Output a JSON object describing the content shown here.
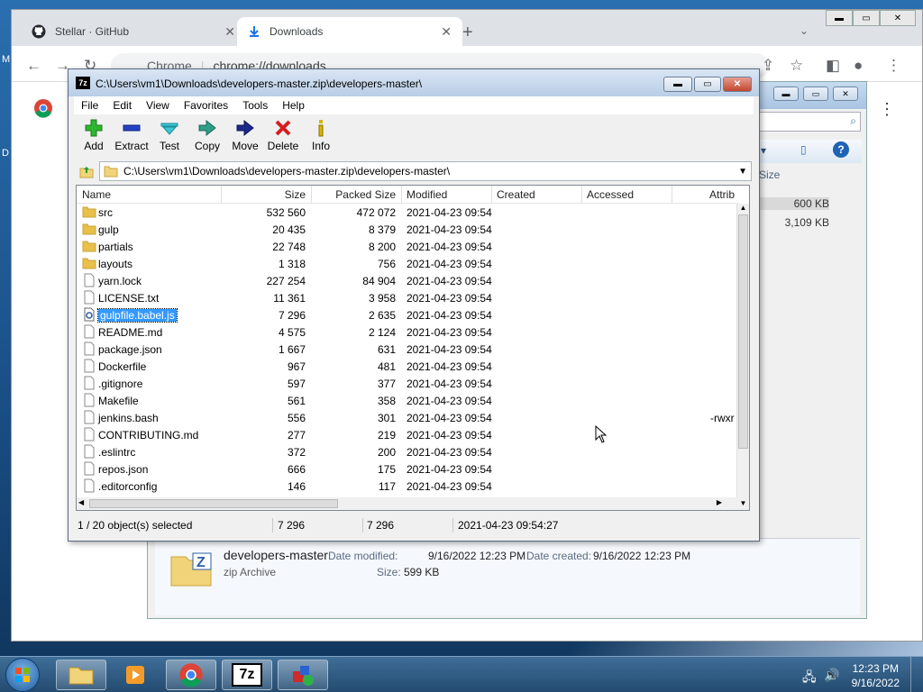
{
  "desktop": {
    "left_label_1": "M",
    "left_label_2": "D"
  },
  "chrome": {
    "tabs": [
      {
        "title": "Stellar · GitHub"
      },
      {
        "title": "Downloads"
      }
    ],
    "omnibox": {
      "site": "Chrome",
      "url": "chrome://downloads"
    }
  },
  "explorer": {
    "column_size": "Size",
    "sizes": [
      "600 KB",
      "3,109 KB"
    ],
    "details": {
      "name": "developers-master",
      "type": "zip Archive",
      "date_modified_label": "Date modified:",
      "date_modified": "9/16/2022 12:23 PM",
      "date_created_label": "Date created:",
      "date_created": "9/16/2022 12:23 PM",
      "size_label": "Size:",
      "size": "599 KB"
    }
  },
  "zip": {
    "title": "C:\\Users\\vm1\\Downloads\\developers-master.zip\\developers-master\\",
    "menu": [
      "File",
      "Edit",
      "View",
      "Favorites",
      "Tools",
      "Help"
    ],
    "toolbar": {
      "add": "Add",
      "extract": "Extract",
      "test": "Test",
      "copy": "Copy",
      "move": "Move",
      "delete": "Delete",
      "info": "Info"
    },
    "address": "C:\\Users\\vm1\\Downloads\\developers-master.zip\\developers-master\\",
    "columns": {
      "name": "Name",
      "size": "Size",
      "packed": "Packed Size",
      "modified": "Modified",
      "created": "Created",
      "accessed": "Accessed",
      "attrib": "Attrib"
    },
    "rows": [
      {
        "name": "src",
        "size": "532 560",
        "packed": "472 072",
        "modified": "2021-04-23 09:54",
        "attrib": "",
        "type": "folder"
      },
      {
        "name": "gulp",
        "size": "20 435",
        "packed": "8 379",
        "modified": "2021-04-23 09:54",
        "attrib": "",
        "type": "folder"
      },
      {
        "name": "partials",
        "size": "22 748",
        "packed": "8 200",
        "modified": "2021-04-23 09:54",
        "attrib": "",
        "type": "folder"
      },
      {
        "name": "layouts",
        "size": "1 318",
        "packed": "756",
        "modified": "2021-04-23 09:54",
        "attrib": "",
        "type": "folder"
      },
      {
        "name": "yarn.lock",
        "size": "227 254",
        "packed": "84 904",
        "modified": "2021-04-23 09:54",
        "attrib": "",
        "type": "file"
      },
      {
        "name": "LICENSE.txt",
        "size": "11 361",
        "packed": "3 958",
        "modified": "2021-04-23 09:54",
        "attrib": "",
        "type": "file"
      },
      {
        "name": "gulpfile.babel.js",
        "size": "7 296",
        "packed": "2 635",
        "modified": "2021-04-23 09:54",
        "attrib": "",
        "type": "script"
      },
      {
        "name": "README.md",
        "size": "4 575",
        "packed": "2 124",
        "modified": "2021-04-23 09:54",
        "attrib": "",
        "type": "file"
      },
      {
        "name": "package.json",
        "size": "1 667",
        "packed": "631",
        "modified": "2021-04-23 09:54",
        "attrib": "",
        "type": "file"
      },
      {
        "name": "Dockerfile",
        "size": "967",
        "packed": "481",
        "modified": "2021-04-23 09:54",
        "attrib": "",
        "type": "file"
      },
      {
        "name": ".gitignore",
        "size": "597",
        "packed": "377",
        "modified": "2021-04-23 09:54",
        "attrib": "",
        "type": "file"
      },
      {
        "name": "Makefile",
        "size": "561",
        "packed": "358",
        "modified": "2021-04-23 09:54",
        "attrib": "",
        "type": "file"
      },
      {
        "name": "jenkins.bash",
        "size": "556",
        "packed": "301",
        "modified": "2021-04-23 09:54",
        "attrib": "-rwxr",
        "type": "file"
      },
      {
        "name": "CONTRIBUTING.md",
        "size": "277",
        "packed": "219",
        "modified": "2021-04-23 09:54",
        "attrib": "",
        "type": "file"
      },
      {
        "name": ".eslintrc",
        "size": "372",
        "packed": "200",
        "modified": "2021-04-23 09:54",
        "attrib": "",
        "type": "file"
      },
      {
        "name": "repos.json",
        "size": "666",
        "packed": "175",
        "modified": "2021-04-23 09:54",
        "attrib": "",
        "type": "file"
      },
      {
        "name": ".editorconfig",
        "size": "146",
        "packed": "117",
        "modified": "2021-04-23 09:54",
        "attrib": "",
        "type": "file"
      }
    ],
    "selected_row": "gulpfile.babel.js",
    "status": {
      "selection": "1 / 20 object(s) selected",
      "size": "7 296",
      "packed": "7 296",
      "modified": "2021-04-23 09:54:27"
    }
  },
  "taskbar": {
    "time": "12:23 PM",
    "date": "9/16/2022",
    "zip_label": "7z"
  },
  "colors": {
    "selection": "#3399ff",
    "folder": "#e8c04a",
    "taskbar": "#2c5680"
  }
}
